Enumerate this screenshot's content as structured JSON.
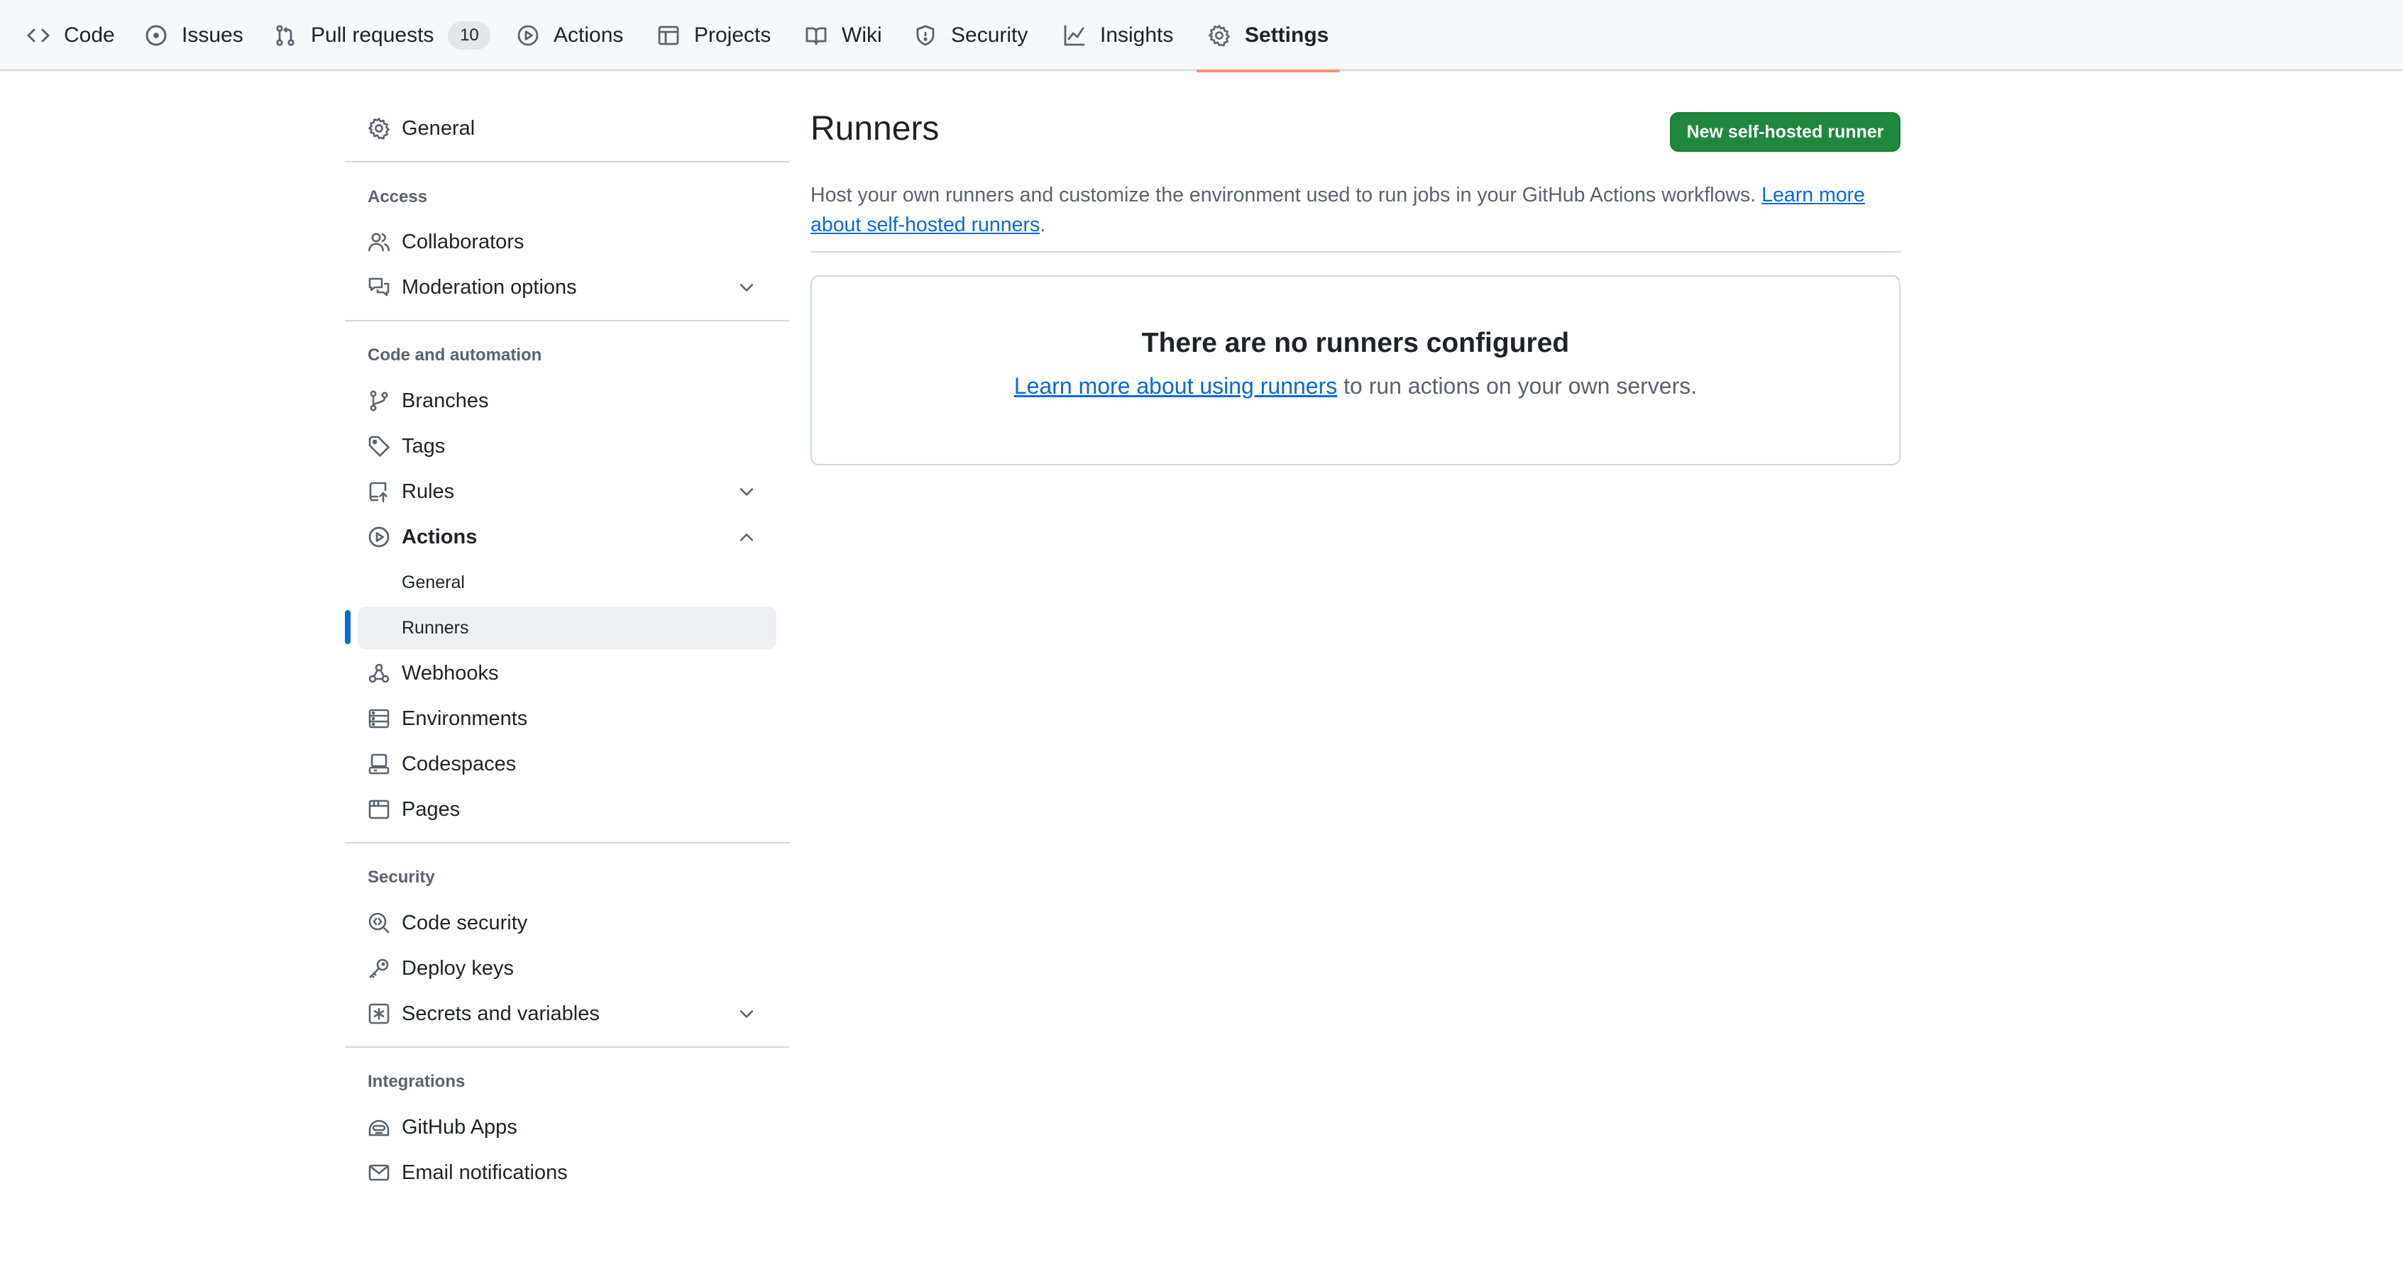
{
  "topnav": {
    "tabs": [
      {
        "label": "Code",
        "icon": "code-icon"
      },
      {
        "label": "Issues",
        "icon": "issue-opened-icon"
      },
      {
        "label": "Pull requests",
        "icon": "git-pull-request-icon",
        "count": "10"
      },
      {
        "label": "Actions",
        "icon": "play-icon"
      },
      {
        "label": "Projects",
        "icon": "table-icon"
      },
      {
        "label": "Wiki",
        "icon": "book-icon"
      },
      {
        "label": "Security",
        "icon": "shield-icon"
      },
      {
        "label": "Insights",
        "icon": "graph-icon"
      },
      {
        "label": "Settings",
        "icon": "gear-icon",
        "active": true
      }
    ]
  },
  "sidebar": {
    "general": "General",
    "sections": {
      "access": "Access",
      "code_automation": "Code and automation",
      "security": "Security",
      "integrations": "Integrations"
    },
    "items": {
      "collaborators": "Collaborators",
      "moderation": "Moderation options",
      "branches": "Branches",
      "tags": "Tags",
      "rules": "Rules",
      "actions": "Actions",
      "actions_general": "General",
      "actions_runners": "Runners",
      "webhooks": "Webhooks",
      "environments": "Environments",
      "codespaces": "Codespaces",
      "pages": "Pages",
      "code_security": "Code security",
      "deploy_keys": "Deploy keys",
      "secrets": "Secrets and variables",
      "github_apps": "GitHub Apps",
      "email_notifications": "Email notifications"
    },
    "selected": "Runners"
  },
  "main": {
    "title": "Runners",
    "new_button": "New self-hosted runner",
    "description": "Host your own runners and customize the environment used to run jobs in your GitHub Actions workflows.",
    "description_link": "Learn more about self-hosted runners",
    "blank_title": "There are no runners configured",
    "blank_link": "Learn more about using runners",
    "blank_text": " to run actions on your own servers."
  },
  "colors": {
    "accent": "#0969da",
    "primary_button": "#1f883d",
    "active_tab_underline": "#fd8c73"
  }
}
